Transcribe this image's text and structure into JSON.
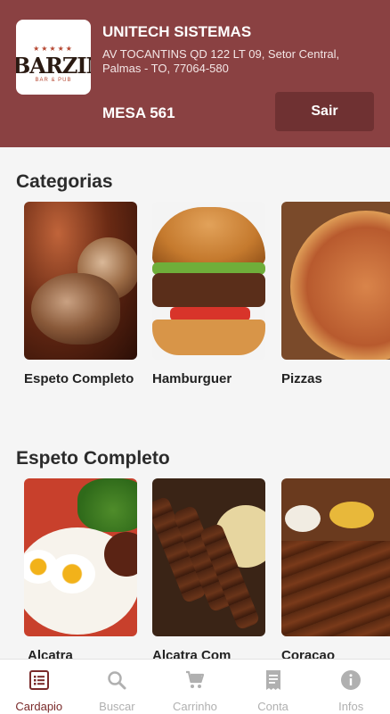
{
  "header": {
    "logo_text": "BARZIM",
    "logo_sub": "BAR & PUB",
    "store_name": "UNITECH SISTEMAS",
    "address": "AV TOCANTINS QD 122 LT 09, Setor Central, Palmas - TO, 77064-580",
    "table": "MESA 561",
    "exit_label": "Sair",
    "colors": {
      "header_bg": "#8a4142",
      "button_bg": "#6f3132"
    }
  },
  "categories": {
    "title": "Categorias",
    "items": [
      {
        "label": "Espeto Completo"
      },
      {
        "label": "Hamburguer"
      },
      {
        "label": "Pizzas"
      }
    ]
  },
  "espeto_section": {
    "title": "Espeto Completo",
    "items": [
      {
        "label": "Alcatra"
      },
      {
        "label": "Alcatra Com"
      },
      {
        "label": "Coracao"
      }
    ]
  },
  "bottom_nav": {
    "items": [
      {
        "label": "Cardapio",
        "icon": "menu-list-icon",
        "active": true
      },
      {
        "label": "Buscar",
        "icon": "search-icon",
        "active": false
      },
      {
        "label": "Carrinho",
        "icon": "cart-icon",
        "active": false
      },
      {
        "label": "Conta",
        "icon": "receipt-icon",
        "active": false
      },
      {
        "label": "Infos",
        "icon": "info-icon",
        "active": false
      }
    ],
    "colors": {
      "active": "#7a2a2a",
      "inactive": "#b0b0b0"
    }
  }
}
